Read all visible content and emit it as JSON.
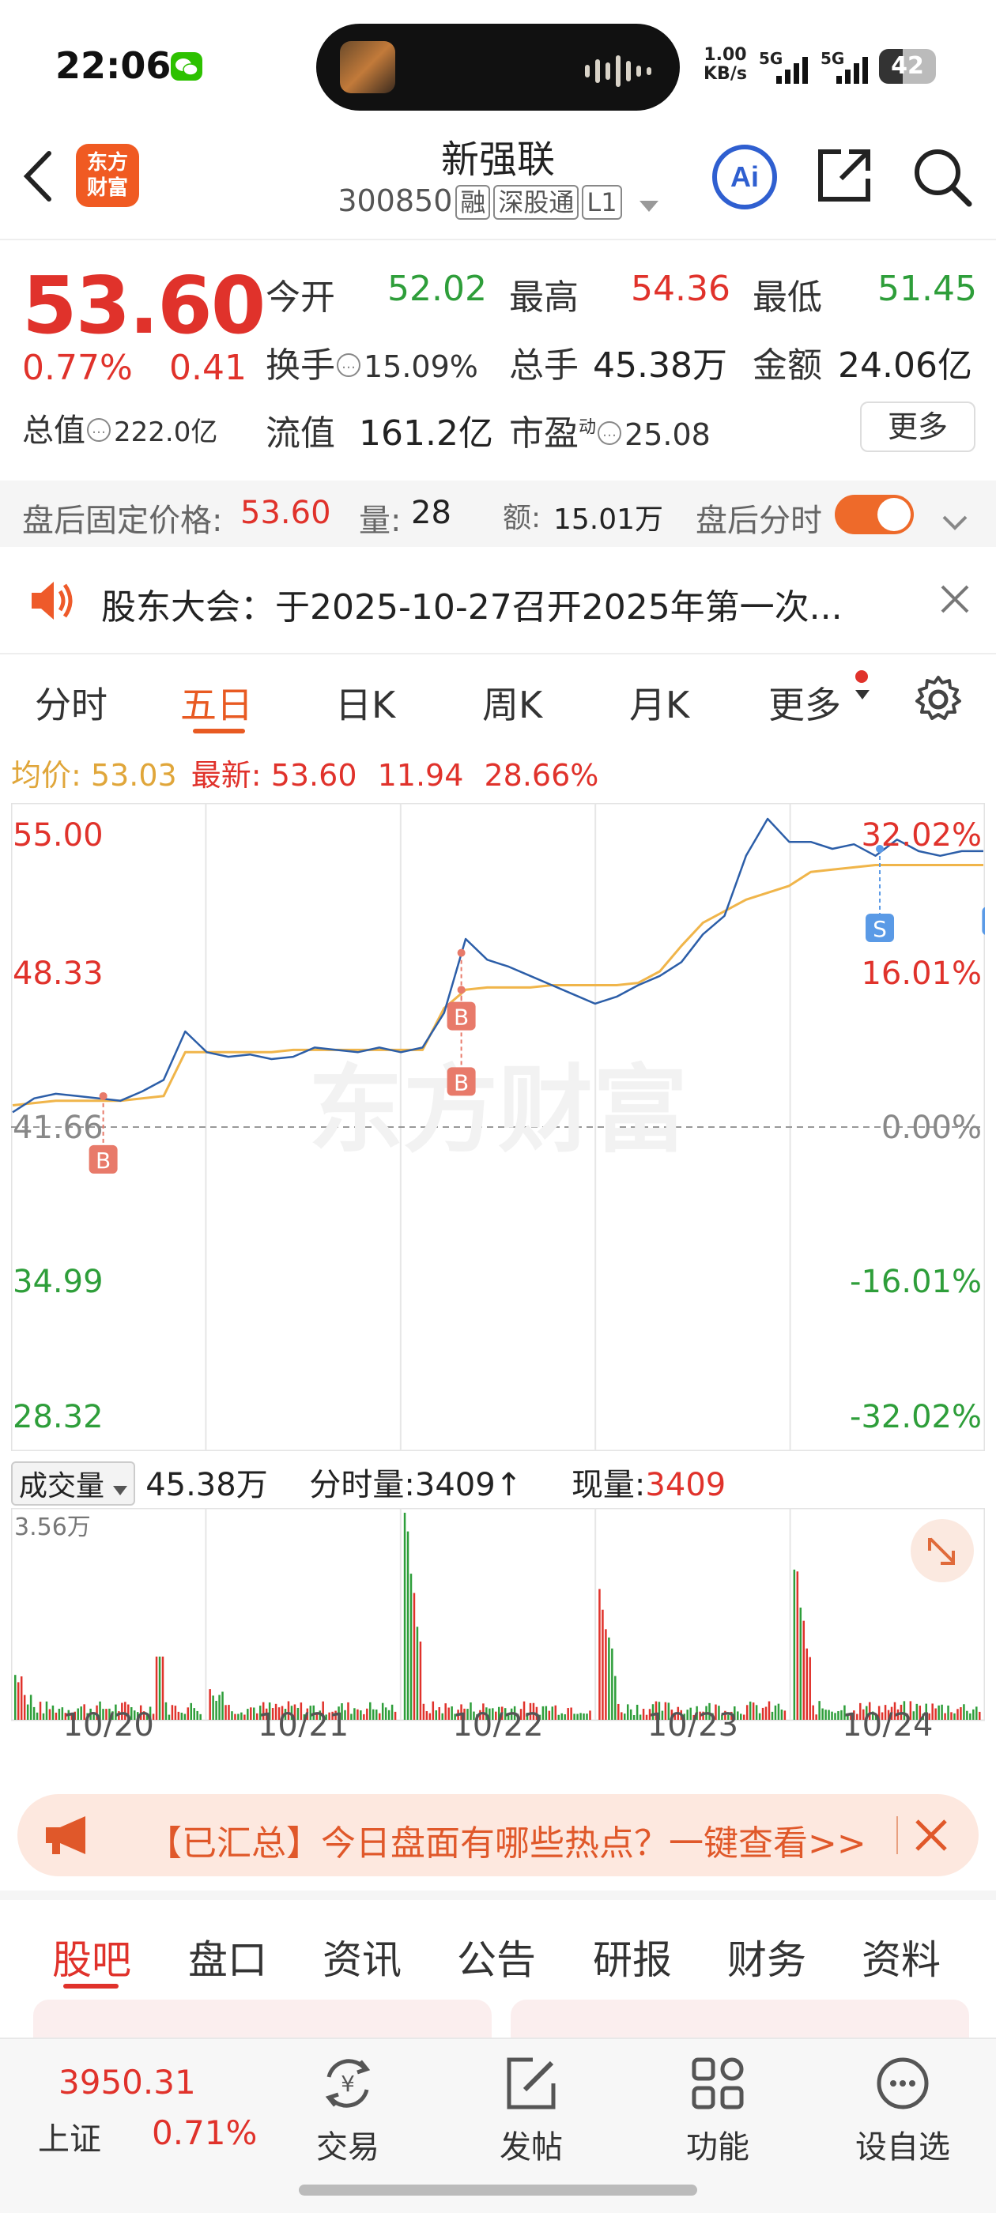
{
  "status_bar": {
    "time": "22:06",
    "net_speed_top": "1.00",
    "net_speed_bottom": "KB/s",
    "signal1": "5G",
    "signal2": "5G",
    "battery": "42"
  },
  "header": {
    "logo_text_line1": "东方",
    "logo_text_line2": "财富",
    "title": "新强联",
    "code": "300850",
    "tag1": "融",
    "tag2": "深股通",
    "tag3": "L1"
  },
  "quote": {
    "price": "53.60",
    "change_pct": "0.77%",
    "change": "0.41",
    "open_label": "今开",
    "open": "52.02",
    "high_label": "最高",
    "high": "54.36",
    "low_label": "最低",
    "low": "51.45",
    "turnover_label": "换手",
    "turnover": "15.09%",
    "volume_label": "总手",
    "volume": "45.38万",
    "amount_label": "金额",
    "amount": "24.06亿",
    "mktcap_label": "总值",
    "mktcap": "222.0亿",
    "float_label": "流值",
    "float": "161.2亿",
    "pe_label": "市盈",
    "pe_sup": "动",
    "pe": "25.08",
    "more": "更多"
  },
  "after_hours": {
    "price_label": "盘后固定价格:",
    "price": "53.60",
    "vol_label": "量:",
    "vol": "28",
    "amt_label": "额:",
    "amt": "15.01万",
    "toggle_label": "盘后分时"
  },
  "notice": {
    "text": "股东大会：于2025-10-27召开2025年第一次..."
  },
  "chart_tabs": [
    "分时",
    "五日",
    "日K",
    "周K",
    "月K",
    "更多"
  ],
  "chart_info": {
    "avg_label": "均价:",
    "avg": "53.03",
    "latest_label": "最新:",
    "latest": "53.60",
    "v1": "11.94",
    "v2": "28.66%"
  },
  "chart_data": {
    "type": "line",
    "title": "",
    "x": [
      "10/20",
      "10/21",
      "10/22",
      "10/23",
      "10/24"
    ],
    "ylim": [
      28.32,
      55.0
    ],
    "y_ticks_left": [
      "55.00",
      "48.33",
      "41.66",
      "34.99",
      "28.32"
    ],
    "y_ticks_right": [
      "32.02%",
      "16.01%",
      "0.00%",
      "-16.01%",
      "-32.02%"
    ],
    "reference_price": 41.66,
    "series": [
      {
        "name": "",
        "color": "#2c5ea8",
        "values": [
          42.3,
          42.9,
          43.1,
          43.0,
          42.9,
          42.8,
          43.2,
          43.7,
          45.8,
          44.9,
          44.7,
          44.8,
          44.6,
          44.7,
          45.1,
          45.0,
          44.9,
          45.1,
          44.9,
          45.1,
          46.6,
          49.8,
          48.9,
          48.6,
          48.2,
          47.8,
          47.4,
          47.0,
          47.3,
          47.8,
          48.2,
          48.8,
          50.0,
          50.8,
          53.4,
          55.0,
          54.0,
          54.0,
          53.7,
          53.9,
          53.4,
          54.1,
          53.6,
          53.4,
          53.6,
          53.6
        ]
      },
      {
        "name": "均价",
        "color": "#f0b54a",
        "values": [
          42.6,
          42.7,
          42.8,
          42.8,
          42.8,
          42.8,
          42.9,
          43.0,
          44.9,
          44.9,
          44.9,
          44.9,
          44.9,
          45.0,
          45.0,
          45.0,
          45.0,
          45.0,
          45.0,
          45.0,
          46.8,
          47.6,
          47.7,
          47.7,
          47.7,
          47.8,
          47.8,
          47.8,
          47.8,
          47.9,
          48.4,
          49.5,
          50.5,
          51.0,
          51.5,
          51.8,
          52.1,
          52.7,
          52.8,
          52.9,
          53.0,
          53.0,
          53.0,
          53.0,
          53.0,
          53.0
        ]
      }
    ],
    "markers": [
      {
        "label": "B",
        "x_index": 4.2,
        "price": 43.0
      },
      {
        "label": "B",
        "x_index": 20.8,
        "price": 49.2
      },
      {
        "label": "B",
        "x_index": 20.8,
        "price": 47.6
      },
      {
        "label": "S",
        "x_index": 40.2,
        "price": 53.7
      },
      {
        "label": "S",
        "x_index": 45.6,
        "price": 54.0
      }
    ]
  },
  "volume": {
    "dropdown": "成交量",
    "total": "45.38万",
    "bar_label": "分时量:",
    "bar_value": "3409",
    "arrow": "↑",
    "now_label": "现量:",
    "now_value": "3409",
    "max_label": "3.56万",
    "max_value_wan": 3.56,
    "dates": [
      "10/20",
      "10/21",
      "10/22",
      "10/23",
      "10/24"
    ]
  },
  "promo": {
    "text": "【已汇总】今日盘面有哪些热点？一键查看>>"
  },
  "sub_tabs": [
    "股吧",
    "盘口",
    "资讯",
    "公告",
    "研报",
    "财务",
    "资料"
  ],
  "bottom_nav": {
    "index_value": "3950.31",
    "index_name": "上证",
    "index_change": "0.71%",
    "items": [
      "交易",
      "发帖",
      "功能",
      "设自选"
    ]
  },
  "watermark": "东方财富",
  "colors": {
    "up": "#e0322b",
    "down": "#2e9e3a",
    "accent": "#e85a22",
    "line": "#2c5ea8",
    "avg": "#f0b54a"
  }
}
